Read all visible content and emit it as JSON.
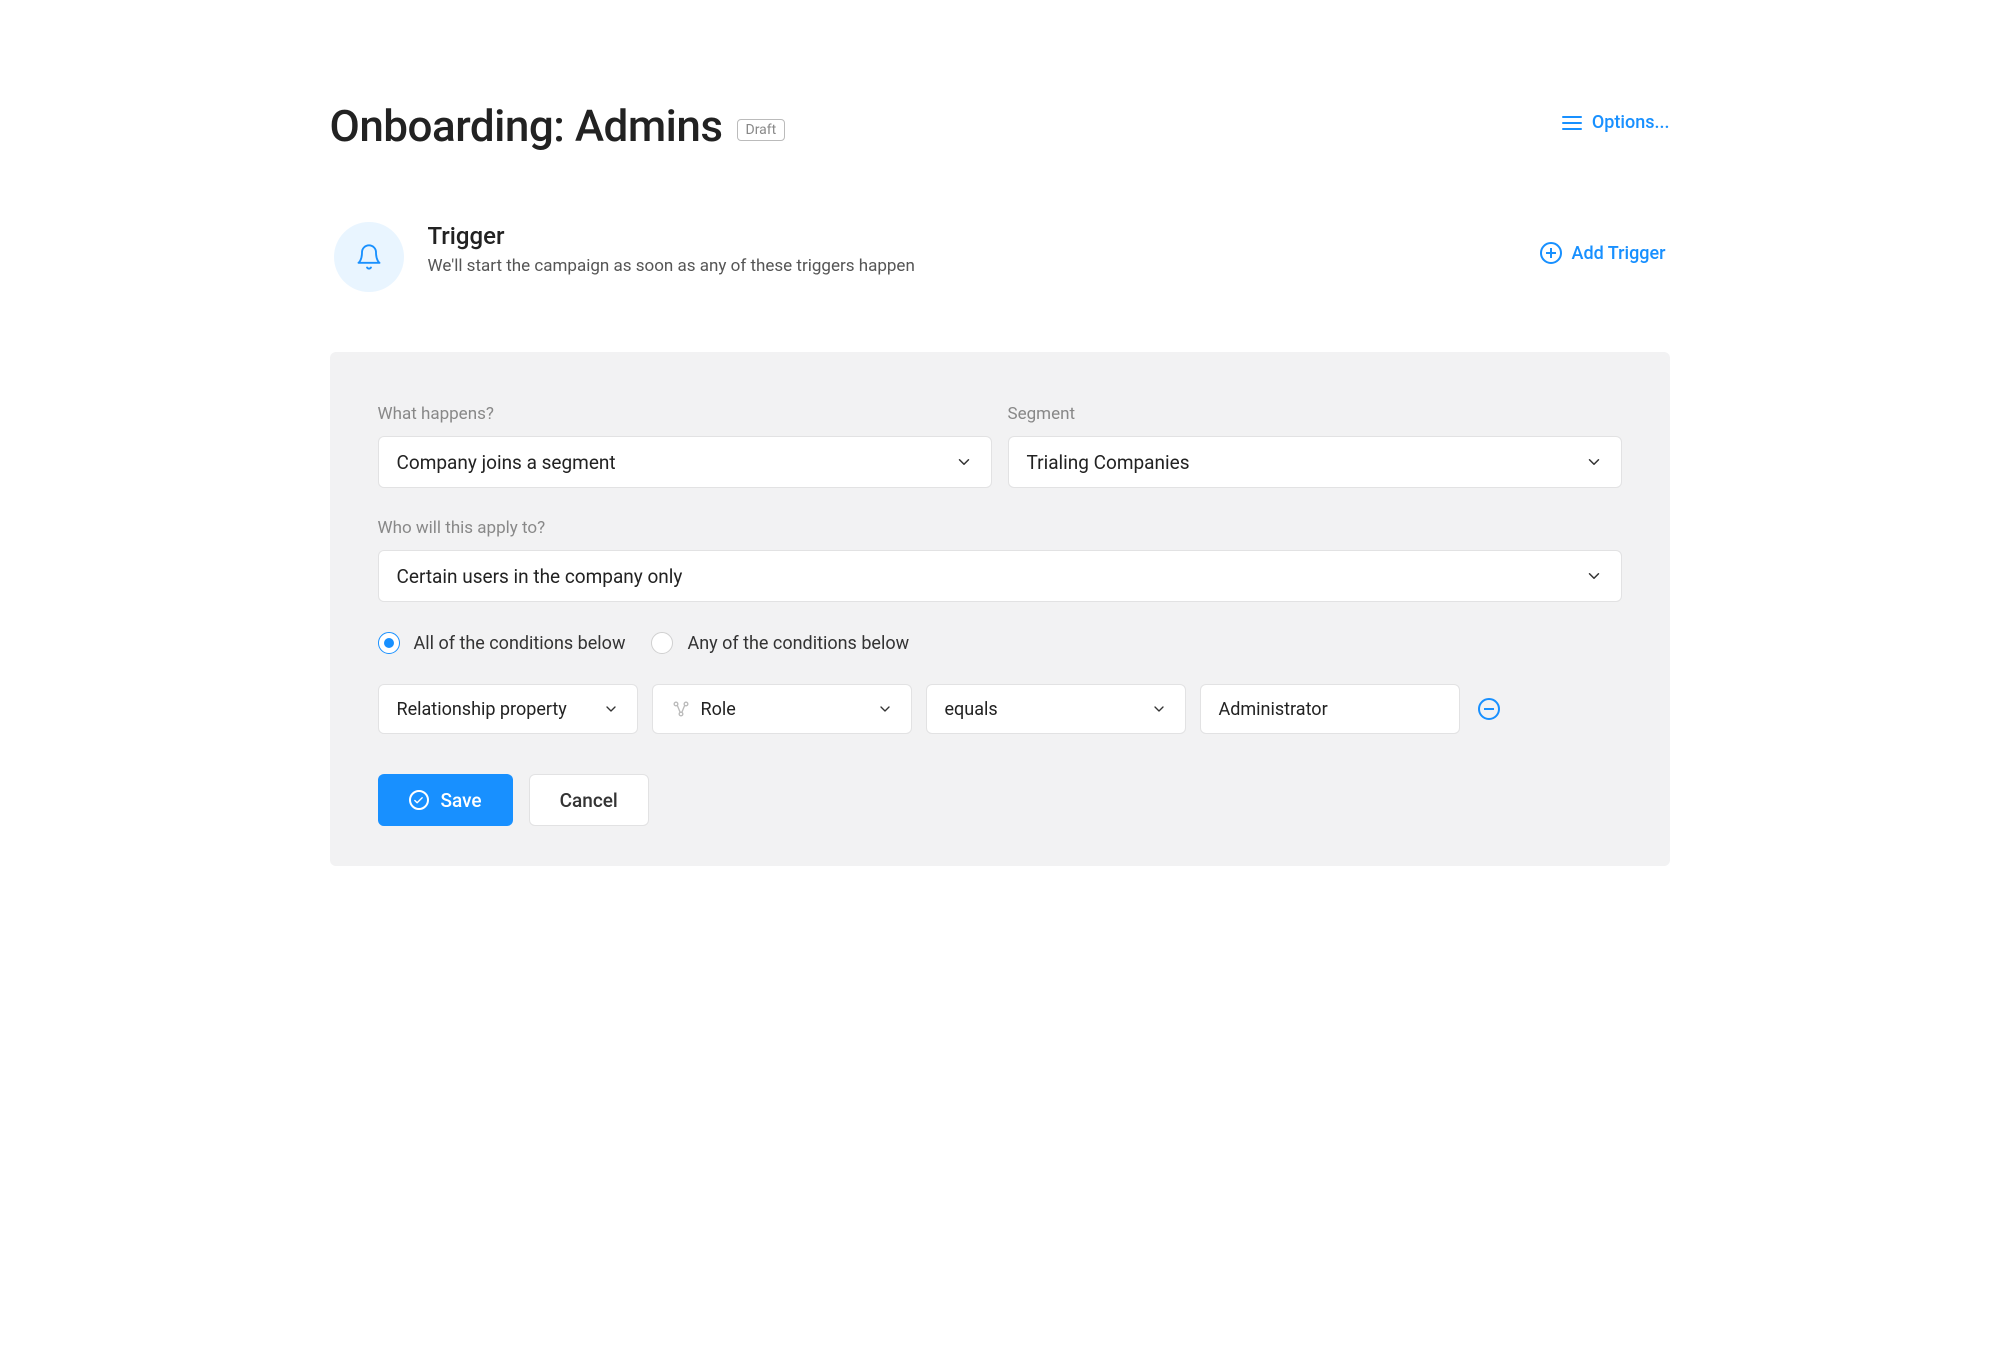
{
  "header": {
    "title": "Onboarding: Admins",
    "status_badge": "Draft",
    "options_label": "Options..."
  },
  "trigger_section": {
    "title": "Trigger",
    "subtitle": "We'll start the campaign as soon as any of these triggers happen",
    "add_label": "Add Trigger"
  },
  "form": {
    "what_happens": {
      "label": "What happens?",
      "value": "Company joins a segment"
    },
    "segment": {
      "label": "Segment",
      "value": "Trialing Companies"
    },
    "apply_to": {
      "label": "Who will this apply to?",
      "value": "Certain users in the company only"
    },
    "logic": {
      "all_label": "All of the conditions below",
      "any_label": "Any of the conditions below"
    },
    "condition": {
      "type": "Relationship property",
      "property": "Role",
      "operator": "equals",
      "value": "Administrator"
    },
    "actions": {
      "save": "Save",
      "cancel": "Cancel"
    }
  },
  "colors": {
    "accent": "#1890ff",
    "card_bg": "#f2f2f3",
    "muted": "#888"
  }
}
